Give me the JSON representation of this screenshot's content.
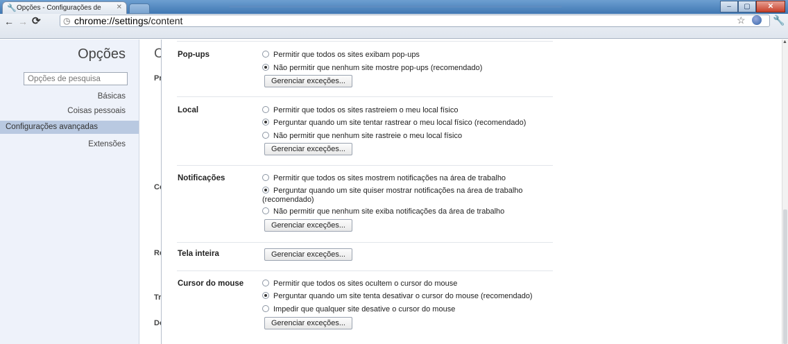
{
  "browser": {
    "tab_title": "Opções - Configurações de",
    "url_host": "chrome://settings",
    "url_path": "/content"
  },
  "sidebar": {
    "title": "Opções",
    "search_placeholder": "Opções de pesquisa",
    "items": [
      {
        "label": "Básicas"
      },
      {
        "label": "Coisas pessoais"
      },
      {
        "label": "Configurações avançadas"
      },
      {
        "label": "Extensões"
      }
    ]
  },
  "background_page": {
    "title_fragment": "C",
    "fragments": [
      "Pr",
      "Co",
      "Re",
      "Tr",
      "Do"
    ]
  },
  "content": {
    "manage_exceptions": "Gerenciar exceções...",
    "sections": [
      {
        "title": "Pop-ups",
        "options": [
          "Permitir que todos os sites exibam pop-ups",
          "Não permitir que nenhum site mostre pop-ups (recomendado)"
        ],
        "selected": 1
      },
      {
        "title": "Local",
        "options": [
          "Permitir que todos os sites rastreiem o meu local físico",
          "Perguntar quando um site tentar rastrear o meu local físico (recomendado)",
          "Não permitir que nenhum site rastreie o meu local físico"
        ],
        "selected": 1
      },
      {
        "title": "Notificações",
        "options": [
          "Permitir que todos os sites mostrem notificações na área de trabalho",
          "Perguntar quando um site quiser mostrar notificações na área de trabalho",
          "(recomendado)",
          "Não permitir que nenhum site exiba notificações da área de trabalho"
        ],
        "selected": 1
      },
      {
        "title": "Tela inteira",
        "options": [],
        "selected": null
      },
      {
        "title": "Cursor do mouse",
        "options": [
          "Permitir que todos os sites ocultem o cursor do mouse",
          "Perguntar quando um site tenta desativar o cursor do mouse (recomendado)",
          "Impedir que qualquer site desative o cursor do mouse"
        ],
        "selected": 1
      }
    ]
  }
}
